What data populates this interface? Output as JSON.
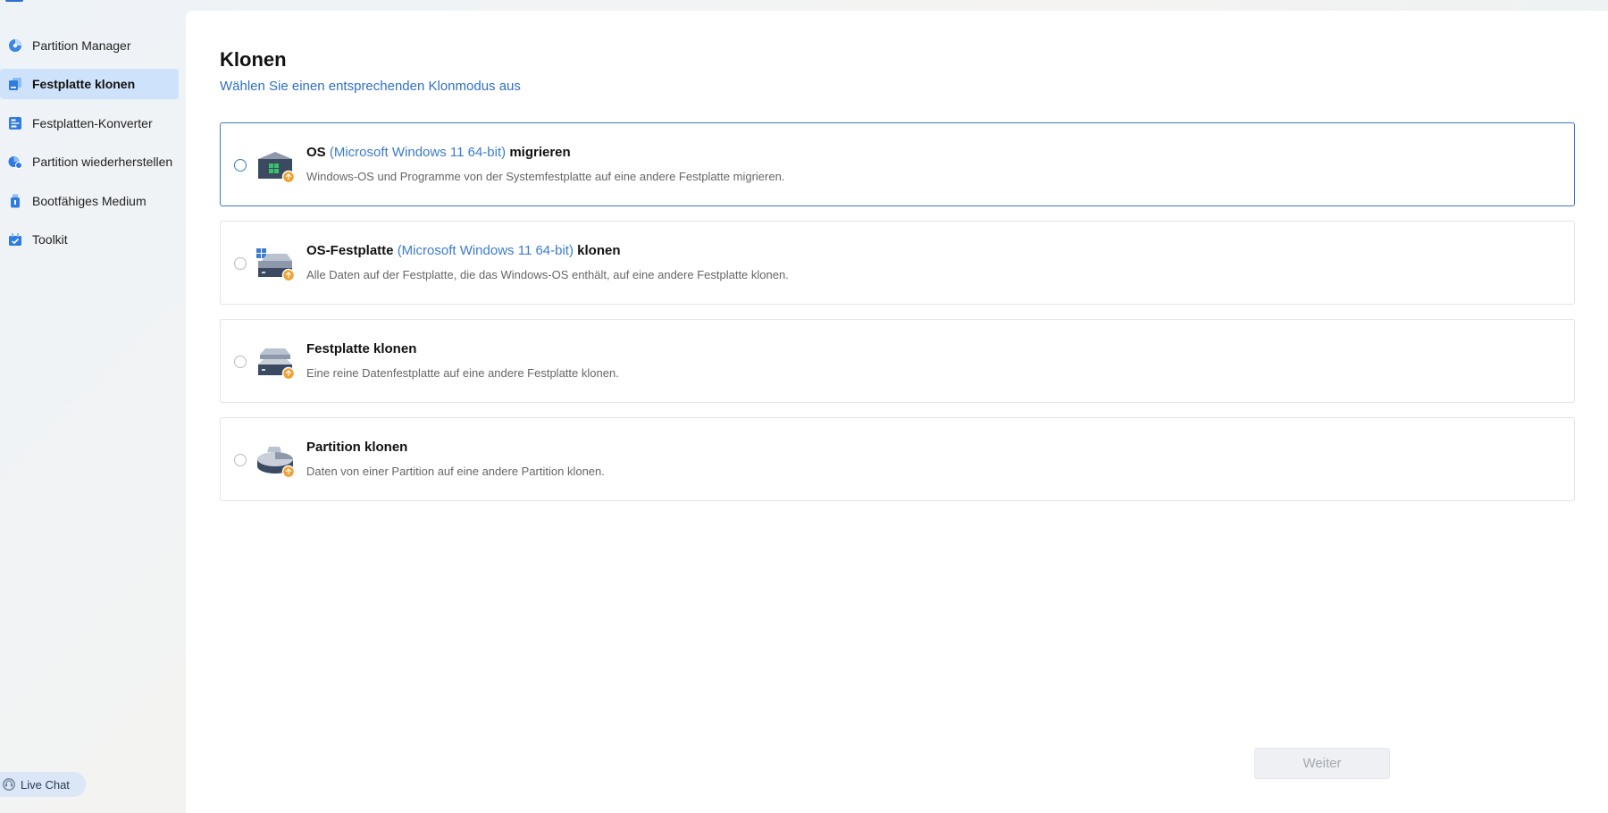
{
  "sidebar": {
    "items": [
      {
        "label": "Partition Manager",
        "icon": "pie-chart-icon",
        "active": false
      },
      {
        "label": "Festplatte klonen",
        "icon": "clone-disk-icon",
        "active": true
      },
      {
        "label": "Festplatten-Konverter",
        "icon": "converter-icon",
        "active": false
      },
      {
        "label": "Partition wiederherstellen",
        "icon": "recover-partition-icon",
        "active": false
      },
      {
        "label": "Bootfähiges Medium",
        "icon": "usb-drive-icon",
        "active": false
      },
      {
        "label": "Toolkit",
        "icon": "toolkit-icon",
        "active": false
      }
    ],
    "live_chat": {
      "label": "Live Chat",
      "icon": "headset-icon"
    }
  },
  "main": {
    "title": "Klonen",
    "subtitle": "Wählen Sie einen entsprechenden Klonmodus aus",
    "options": [
      {
        "title_pre": "OS",
        "title_highlight": "(Microsoft Windows 11 64-bit)",
        "title_post": "migrieren",
        "description": "Windows-OS und Programme von der Systemfestplatte auf eine andere Festplatte migrieren.",
        "icon": "os-migrate-icon",
        "selected": true
      },
      {
        "title_pre": "OS-Festplatte",
        "title_highlight": "(Microsoft Windows 11 64-bit)",
        "title_post": "klonen",
        "description": "Alle Daten auf der Festplatte, die das Windows-OS enthält, auf eine andere Festplatte klonen.",
        "icon": "os-disk-clone-icon",
        "selected": false
      },
      {
        "title_pre": "Festplatte klonen",
        "title_highlight": "",
        "title_post": "",
        "description": "Eine reine Datenfestplatte auf eine andere Festplatte klonen.",
        "icon": "disk-clone-icon",
        "selected": false
      },
      {
        "title_pre": "Partition klonen",
        "title_highlight": "",
        "title_post": "",
        "description": "Daten von einer Partition auf eine andere Partition klonen.",
        "icon": "partition-clone-icon",
        "selected": false
      }
    ],
    "next_button": {
      "label": "Weiter",
      "enabled": false
    }
  },
  "colors": {
    "accent": "#2f6fc9",
    "highlight_text": "#3b7bd0",
    "active_nav_bg": "#cfe2fb",
    "badge_orange": "#f0a030"
  }
}
